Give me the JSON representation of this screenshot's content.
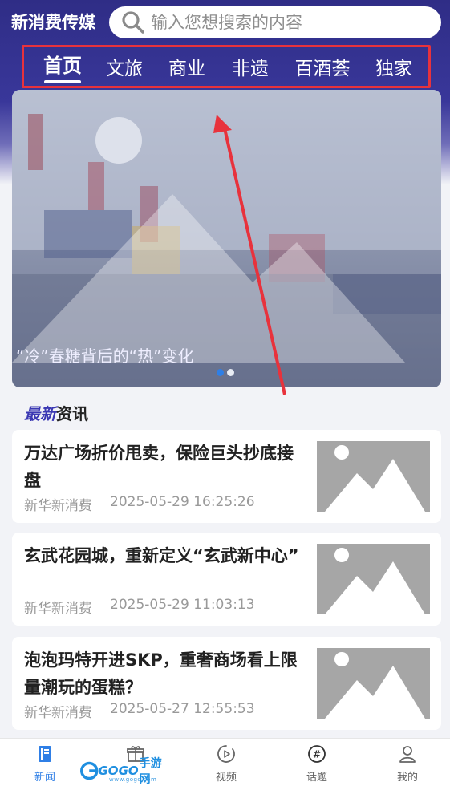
{
  "header": {
    "logo_text": "新消费传媒",
    "search_placeholder": "输入您想搜索的内容"
  },
  "nav": {
    "tabs": [
      {
        "label": "首页",
        "active": true
      },
      {
        "label": "文旅",
        "active": false
      },
      {
        "label": "商业",
        "active": false
      },
      {
        "label": "非遗",
        "active": false
      },
      {
        "label": "百酒荟",
        "active": false
      },
      {
        "label": "独家",
        "active": false
      }
    ]
  },
  "banner": {
    "caption": "“冷”春糖背后的“热”变化",
    "slide_count": 2,
    "active_slide": 1
  },
  "section": {
    "title_highlight": "最新",
    "title_rest": "资讯"
  },
  "news": [
    {
      "title": "万达广场折价甩卖，保险巨头抄底接盘",
      "source": "新华新消费",
      "time": "2025-05-29 16:25:26"
    },
    {
      "title": "玄武花园城，重新定义“玄武新中心”",
      "source": "新华新消费",
      "time": "2025-05-29 11:03:13"
    },
    {
      "title": "泡泡玛特开进SKP，重奢商场看上限量潮玩的蛋糕？",
      "source": "新华新消费",
      "time": "2025-05-27 12:55:53"
    }
  ],
  "tabbar": {
    "items": [
      {
        "label": "新闻",
        "icon": "news-book-icon",
        "active": true
      },
      {
        "label": "",
        "icon": "gift-icon",
        "active": false
      },
      {
        "label": "视频",
        "icon": "video-play-icon",
        "active": false
      },
      {
        "label": "话题",
        "icon": "topic-hash-icon",
        "active": false
      },
      {
        "label": "我的",
        "icon": "profile-icon",
        "active": false
      }
    ]
  },
  "watermark": {
    "brand": "GOGO",
    "brand_cn": "手游网",
    "url": "www.gogo.com"
  },
  "colors": {
    "header_bg": "#2f2d86",
    "accent": "#2f7fe6",
    "highlight_border": "#e8323c",
    "section_highlight": "#3b38b3"
  }
}
